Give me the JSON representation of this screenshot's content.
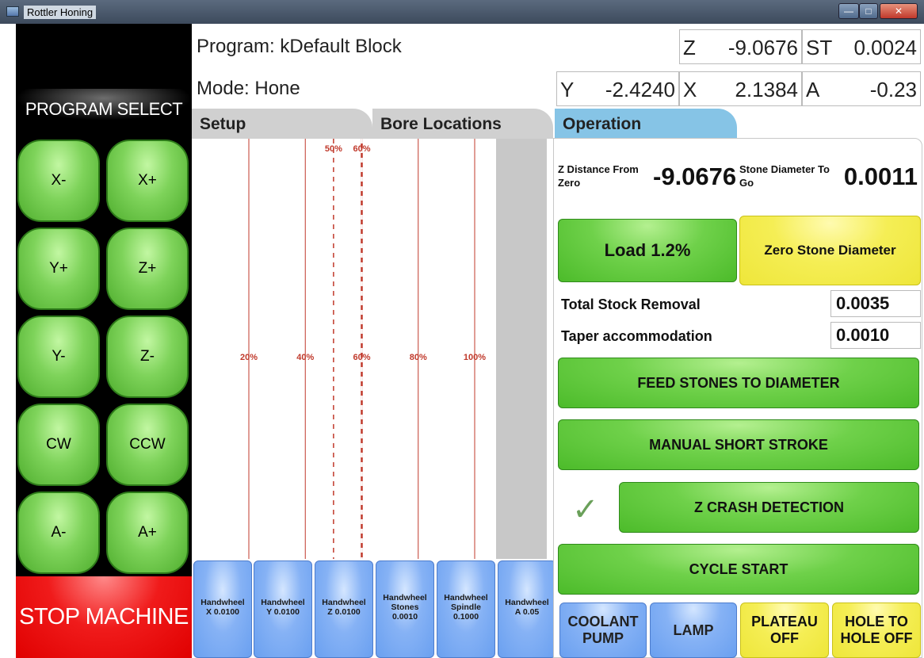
{
  "window": {
    "title": "Rottler Honing"
  },
  "left_panel": {
    "program_select": "PROGRAM SELECT",
    "jog_buttons": [
      "X-",
      "X+",
      "Y+",
      "Z+",
      "Y-",
      "Z-",
      "CW",
      "CCW",
      "A-",
      "A+"
    ],
    "stop_label": "STOP MACHINE"
  },
  "header": {
    "program": "Program: kDefault Block",
    "mode": "Mode: Hone",
    "readouts": [
      {
        "label": "Z",
        "value": "-9.0676"
      },
      {
        "label": "ST",
        "value": "0.0024"
      },
      {
        "label": "Y",
        "value": "-2.4240"
      },
      {
        "label": "X",
        "value": "2.1384"
      },
      {
        "label": "A",
        "value": "-0.23"
      }
    ]
  },
  "tabs": [
    "Setup",
    "Bore Locations",
    "Operation"
  ],
  "chart_data": {
    "type": "other",
    "top_labels": [
      "50%",
      "60%"
    ],
    "mid_labels": [
      "20%",
      "40%",
      "60%",
      "80%",
      "100%"
    ],
    "solid_lines_pct": [
      20,
      40,
      60,
      80,
      100
    ],
    "dashed_lines_pct": [
      50,
      60
    ],
    "colors": {
      "line": "#c0392b",
      "grey_bar": "#c8c8c8"
    }
  },
  "handwheels": [
    {
      "name": "Handwheel",
      "sub": "X 0.0100",
      "extra": ""
    },
    {
      "name": "Handwheel",
      "sub": "Y 0.0100",
      "extra": ""
    },
    {
      "name": "Handwheel",
      "sub": "Z 0.0100",
      "extra": ""
    },
    {
      "name": "Handwheel",
      "sub": "Stones",
      "extra": "0.0010"
    },
    {
      "name": "Handwheel",
      "sub": "Spindle",
      "extra": "0.1000"
    },
    {
      "name": "Handwheel",
      "sub": "A 0.05",
      "extra": ""
    }
  ],
  "operation": {
    "z_distance_label": "Z Distance From Zero",
    "z_distance_value": "-9.0676",
    "stone_label": "Stone Diameter To Go",
    "stone_value": "0.0011",
    "load_button": "Load 1.2%",
    "zero_stone_button": "Zero Stone Diameter",
    "total_stock_label": "Total Stock Removal",
    "total_stock_value": "0.0035",
    "taper_label": "Taper accommodation",
    "taper_value": "0.0010",
    "feed_button": "FEED STONES TO DIAMETER",
    "short_stroke_button": "MANUAL SHORT STROKE",
    "z_crash_button": "Z CRASH DETECTION",
    "z_crash_checked": true,
    "cycle_start_button": "CYCLE START",
    "bottom_buttons": [
      {
        "label": "COOLANT PUMP",
        "color": "blue"
      },
      {
        "label": "LAMP",
        "color": "blue"
      },
      {
        "label": "PLATEAU OFF",
        "color": "yellow"
      },
      {
        "label": "HOLE TO HOLE OFF",
        "color": "yellow"
      }
    ]
  },
  "icons": {
    "check": "checkmark-icon",
    "app": "app-icon"
  },
  "colors": {
    "green": "#6fd14a",
    "yellow": "#f5ee55",
    "blue": "#86b2f5",
    "red": "#e00000",
    "tab_active": "#86c4e6"
  }
}
